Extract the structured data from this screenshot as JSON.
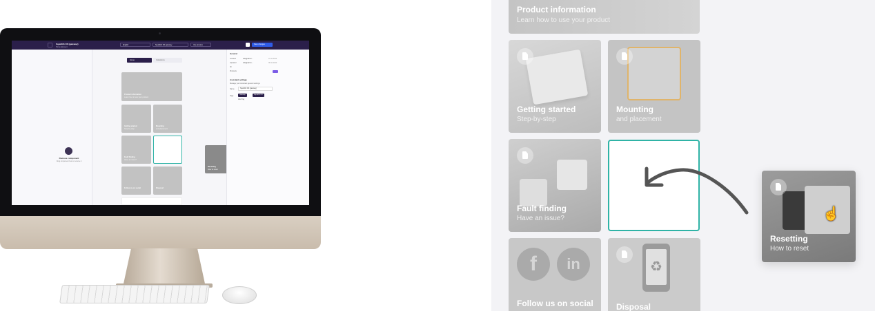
{
  "app": {
    "title": "SquidGS CR (gateway)",
    "subtitle": "Home Element",
    "language": "English",
    "device_select": "SquidGS CR gateway",
    "preview": "Use preview",
    "save": "Save changes",
    "tabs": [
      "Home",
      "Collections"
    ],
    "remove_component": {
      "title": "Remove component",
      "hint": "Drag component here to remove it"
    },
    "settings": {
      "general_heading": "General",
      "rows": [
        {
          "label": "Created",
          "value": "info@airinn...",
          "date": "01.11.2022"
        },
        {
          "label": "Updated",
          "value": "info@airinn...",
          "date": "08.11.2022"
        },
        {
          "label": "ID",
          "value": "",
          "date": ""
        },
        {
          "label": "Products",
          "value": "",
          "date": ""
        }
      ],
      "assistant_heading": "Assistant settings",
      "assistant_hint": "Manage your Assistant general settings",
      "name_label": "Name",
      "name_value": "SquidGS CR (gateway)",
      "tags_label": "Tags",
      "tags": [
        "Gateway",
        "SquidGS CR"
      ],
      "add_tag": "Add Tag"
    }
  },
  "zoom": {
    "top_card": {
      "title": "Product information",
      "subtitle": "Learn how to use your product"
    },
    "cards": [
      {
        "title": "Getting started",
        "subtitle": "Step-by-step"
      },
      {
        "title": "Mounting",
        "subtitle": "and placement"
      },
      {
        "title": "Fault finding",
        "subtitle": "Have an issue?"
      },
      {
        "title": "Follow us on social",
        "subtitle": ""
      },
      {
        "title": "Disposal",
        "subtitle": ""
      }
    ],
    "dragged_card": {
      "title": "Resetting",
      "subtitle": "How to reset"
    }
  },
  "colors": {
    "brand_dark": "#2b1f4a",
    "accent_teal": "#2fb3a6",
    "save_blue": "#2f5be7",
    "arrow": "#555555"
  }
}
